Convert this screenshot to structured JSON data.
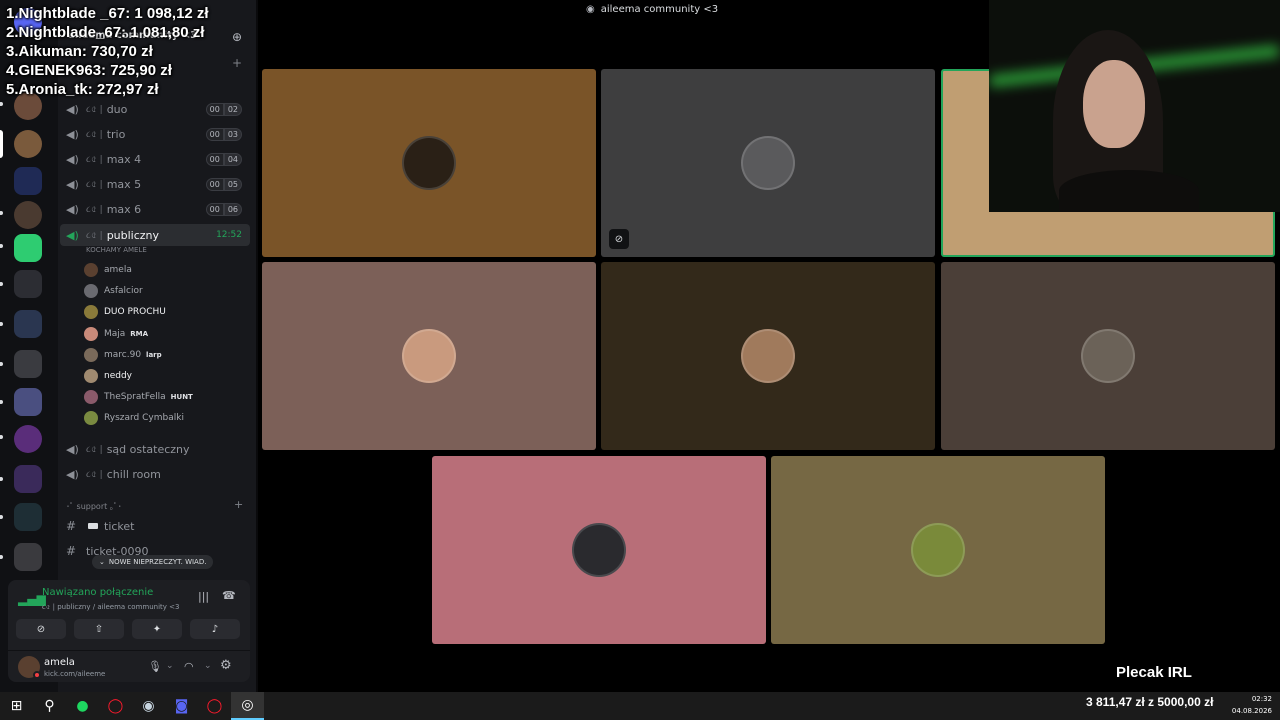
{
  "window": {
    "title": "aileema community <3",
    "server_icon": "server-icon"
  },
  "overlay": {
    "top_donors": [
      "1.Nightblade _67: 1 098,12 zł",
      "2.Nightblade_67: 1 081,80 zł",
      "3.Aikuman: 730,70 zł",
      "4.GIENEK963: 725,90 zł",
      "5.Aronia_tk: 272,97 zł"
    ],
    "goal_title": "Plecak IRL",
    "goal_progress": "3 811,47 zł z 5000,00 zł",
    "goal_fraction": 0.762
  },
  "sidebar": {
    "server_name": "aileema community <3",
    "category_top": "ᘛᘚ",
    "channels": [
      {
        "name": "duo",
        "deco": "૮৫ |",
        "count_a": "00",
        "count_b": "02"
      },
      {
        "name": "trio",
        "deco": "૮৫ |",
        "count_a": "00",
        "count_b": "03"
      },
      {
        "name": "max 4",
        "deco": "૮৫ |",
        "count_a": "00",
        "count_b": "04"
      },
      {
        "name": "max 5",
        "deco": "૮৫ |",
        "count_a": "00",
        "count_b": "05"
      },
      {
        "name": "max 6",
        "deco": "૮৫ |",
        "count_a": "00",
        "count_b": "06"
      }
    ],
    "active_channel": {
      "name": "publiczny",
      "deco": "૮৫ |",
      "time": "12:52",
      "status": "KOCHAMY AMELE"
    },
    "members": [
      {
        "name": "amela"
      },
      {
        "name": "Asfalcior"
      },
      {
        "name": "DUO PROCHU"
      },
      {
        "name": "Maja",
        "tag": "RMA"
      },
      {
        "name": "marc.90",
        "tag": "larp"
      },
      {
        "name": "neddy"
      },
      {
        "name": "TheSpratFella",
        "tag": "HUNT"
      },
      {
        "name": "Ryszard Cymbalki"
      }
    ],
    "more_channels": [
      {
        "name": "sąd ostateczny",
        "deco": "૮৫ |"
      },
      {
        "name": "chill room",
        "deco": "૮৫ |"
      }
    ],
    "support_category": "･ﾟ support ｡ﾟ･",
    "text_channels": [
      "ticket",
      "ticket-0090"
    ],
    "unread_pill": "NOWE NIEPRZECZYT. WIAD."
  },
  "voice": {
    "status": "Nawiązano połączenie",
    "location": "૮৫ | publiczny / aileema community <3"
  },
  "user": {
    "name": "amela",
    "status": "kick.com/aileeme"
  },
  "tiles": [
    {
      "color": "#7a5428",
      "avatar": "#2a2016"
    },
    {
      "color": "#3e3e3f",
      "avatar": "#5a5a5c",
      "muted": true
    },
    {
      "color": "#c09e72",
      "avatar": "#c09e72"
    },
    {
      "color": "#7c6058",
      "avatar": "#c99a7e"
    },
    {
      "color": "#33291a",
      "avatar": "#a07a5c"
    },
    {
      "color": "#4b3f38",
      "avatar": "#6b6258"
    },
    {
      "color": "#b86e78",
      "avatar": "#2a2a2e"
    },
    {
      "color": "#766844",
      "avatar": "#7a8a3a"
    }
  ],
  "taskbar": {
    "time": "02:32",
    "date": "04.08.2026"
  },
  "colors": {
    "accent_green": "#23a55a",
    "rail_bg": "#101114",
    "sidebar_bg": "#17181c"
  }
}
